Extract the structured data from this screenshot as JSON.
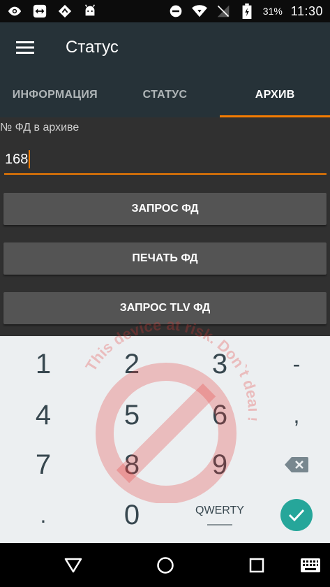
{
  "status_bar": {
    "icons_left": [
      "eye-icon",
      "teamviewer-icon",
      "navigation-icon",
      "android-icon"
    ],
    "icons_right": [
      "do-not-disturb-icon",
      "wifi-icon",
      "no-signal-icon",
      "battery-icon"
    ],
    "battery_percent": "31%",
    "time": "11:30"
  },
  "app_bar": {
    "title": "Статус",
    "menu_icon": "hamburger-menu-icon"
  },
  "tabs": [
    {
      "label": "ИНФОРМАЦИЯ",
      "active": false
    },
    {
      "label": "СТАТУС",
      "active": false
    },
    {
      "label": "АРХИВ",
      "active": true
    }
  ],
  "form": {
    "field_label": "№ ФД в архиве",
    "field_value": "168"
  },
  "buttons": {
    "request_fd": "ЗАПРОС ФД",
    "print_fd": "ПЕЧАТЬ ФД",
    "request_tlv_fd": "ЗАПРОС TLV ФД"
  },
  "keyboard": {
    "keys": [
      "1",
      "2",
      "3",
      "-",
      "4",
      "5",
      "6",
      ",",
      "7",
      "8",
      "9",
      ".",
      "0"
    ],
    "qwerty_label": "QWERTY",
    "backspace_icon": "backspace-icon",
    "enter_icon": "check-icon"
  },
  "watermark": {
    "text": "This device at risk. Don`t deal !"
  },
  "nav_bar": {
    "icons": [
      "back-icon",
      "home-icon",
      "recents-icon",
      "keyboard-switch-icon"
    ]
  },
  "colors": {
    "accent": "#f57c00",
    "app_bar": "#263238",
    "content_bg": "#303030",
    "button_bg": "#545454",
    "keyboard_bg": "#eceff1",
    "enter_key": "#26a69a",
    "watermark": "#e53935"
  }
}
